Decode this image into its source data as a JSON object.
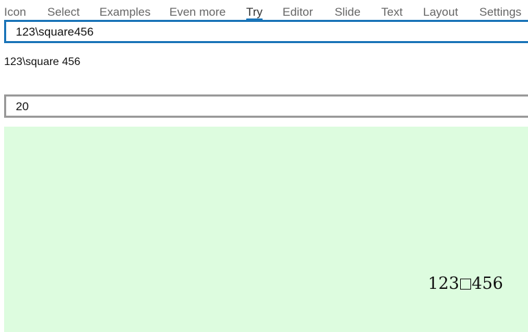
{
  "tabs": [
    {
      "label": "Icon",
      "active": false
    },
    {
      "label": "Select",
      "active": false
    },
    {
      "label": "Examples",
      "active": false
    },
    {
      "label": "Even more",
      "active": false
    },
    {
      "label": "Try",
      "active": true
    },
    {
      "label": "Editor",
      "active": false
    },
    {
      "label": "Slide",
      "active": false
    },
    {
      "label": "Text",
      "active": false
    },
    {
      "label": "Layout",
      "active": false
    },
    {
      "label": "Settings",
      "active": false
    }
  ],
  "formula_input": {
    "value": "123\\square456"
  },
  "preview": {
    "text": "123\\square 456"
  },
  "size_input": {
    "value": "20"
  },
  "render": {
    "before": "123",
    "symbol": "square-icon",
    "after": "456",
    "background": "#ddfcdf"
  },
  "colors": {
    "accent": "#1a74b8",
    "inactive_border": "#999999"
  }
}
